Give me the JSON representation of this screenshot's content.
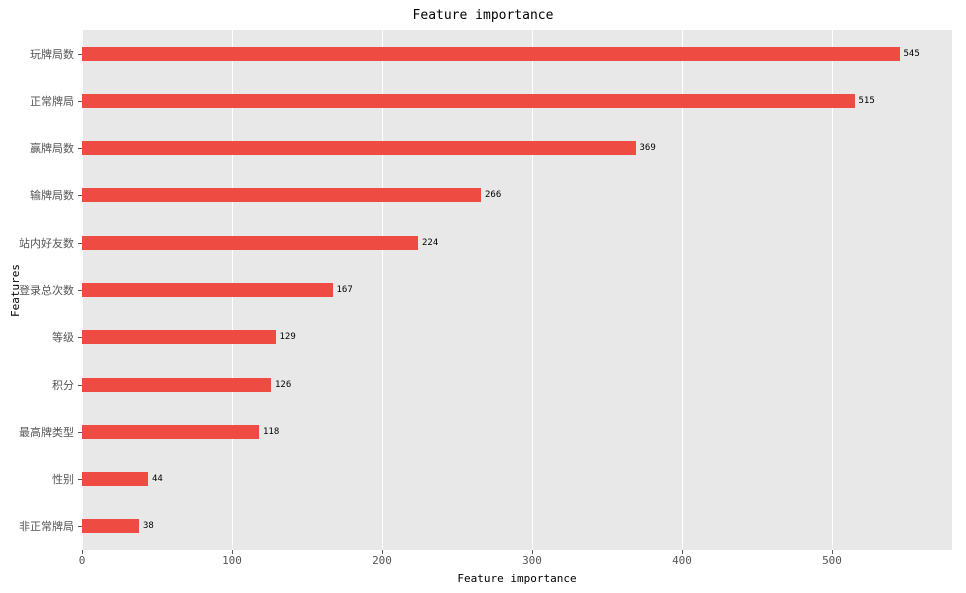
{
  "chart_data": {
    "type": "bar",
    "orientation": "horizontal",
    "title": "Feature importance",
    "xlabel": "Feature importance",
    "ylabel": "Features",
    "xlim": [
      0,
      580
    ],
    "xticks": [
      0,
      100,
      200,
      300,
      400,
      500
    ],
    "categories": [
      "玩牌局数",
      "正常牌局",
      "赢牌局数",
      "输牌局数",
      "站内好友数",
      "登录总次数",
      "等级",
      "积分",
      "最高牌类型",
      "性别",
      "非正常牌局"
    ],
    "values": [
      545,
      515,
      369,
      266,
      224,
      167,
      129,
      126,
      118,
      44,
      38
    ],
    "bar_color": "#ee4c42",
    "bg_color": "#e8e8e8"
  }
}
